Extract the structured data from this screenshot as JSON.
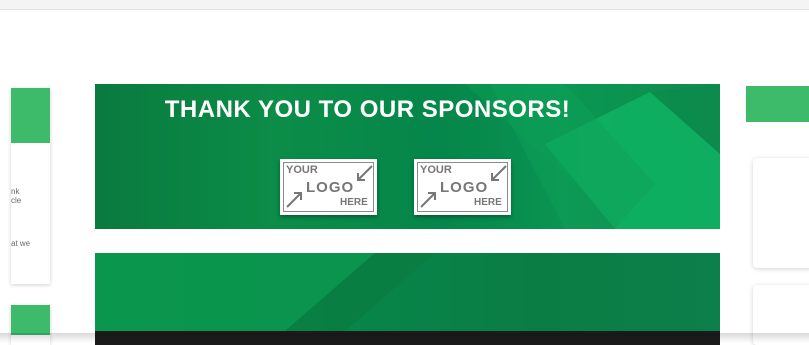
{
  "banner": {
    "title": "THANK YOU TO OUR SPONSORS!",
    "logos": [
      {
        "your": "YOUR",
        "logo": "LOGO",
        "here": "HERE"
      },
      {
        "your": "YOUR",
        "logo": "LOGO",
        "here": "HERE"
      }
    ]
  },
  "left_card": {
    "lines": [
      "nk",
      "cle",
      "at we"
    ]
  },
  "colors": {
    "accent_green": "#3dbb6b",
    "banner_green": "#0b8d48",
    "banner_light": "#19c26f"
  }
}
